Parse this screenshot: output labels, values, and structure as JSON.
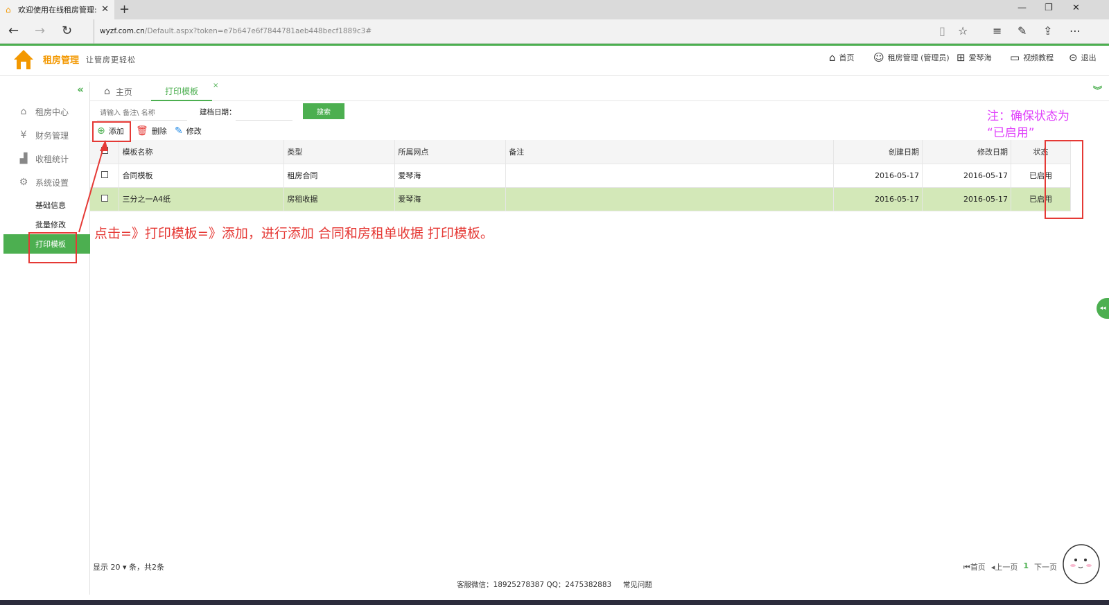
{
  "browser": {
    "tab_title": "欢迎使用在线租房管理:",
    "url_host": "wyzf.com.cn",
    "url_path": "/Default.aspx?token=e7b647e6f7844781aeb448becf1889c3#"
  },
  "header": {
    "brand": "租房管理",
    "slogan": "让管房更轻松",
    "nav": {
      "home": "首页",
      "user": "租房管理 (管理员)",
      "org": "爱琴海",
      "video": "视频教程",
      "logout": "退出"
    }
  },
  "sidebar": {
    "items": [
      {
        "label": "租房中心",
        "icon": "home-icon"
      },
      {
        "label": "财务管理",
        "icon": "finance-icon"
      },
      {
        "label": "收租统计",
        "icon": "bar-chart-icon"
      },
      {
        "label": "系统设置",
        "icon": "gear-icon"
      }
    ],
    "subitems": [
      {
        "label": "基础信息"
      },
      {
        "label": "批量修改"
      },
      {
        "label": "打印模板"
      }
    ]
  },
  "tabs": {
    "home": "主页",
    "active": "打印模板",
    "close": "×"
  },
  "search": {
    "placeholder": "请输入 备注\\ 名称",
    "date_label": "建档日期：",
    "button": "搜索"
  },
  "toolbar": {
    "add": "添加",
    "delete": "删除",
    "edit": "修改"
  },
  "table": {
    "headers": [
      "模板名称",
      "类型",
      "所属网点",
      "备注",
      "创建日期",
      "修改日期",
      "状态"
    ],
    "rows": [
      [
        "合同模板",
        "租房合同",
        "爱琴海",
        "",
        "2016-05-17",
        "2016-05-17",
        "已启用"
      ],
      [
        "三分之一A4纸",
        "房租收据",
        "爱琴海",
        "",
        "2016-05-17",
        "2016-05-17",
        "已启用"
      ]
    ]
  },
  "pager": {
    "show_prefix": "显示",
    "page_size": "20",
    "summary": "条，共2条",
    "first": "首页",
    "prev": "上一页",
    "current": "1",
    "next": "下一页"
  },
  "footer": {
    "service": "客服微信：18925278387  QQ：2475382883",
    "faq": "常见问题"
  },
  "annotations": {
    "instruction": "点击=》打印模板=》添加，进行添加 合同和房租单收据 打印模板。",
    "note_line1": "注：确保状态为",
    "note_line2": "“已启用”"
  },
  "colors": {
    "accent": "#4caf50",
    "brand": "#f39800",
    "annotation_red": "#e53935",
    "annotation_pink": "#e040fb",
    "selected_row": "#d3e8b8"
  }
}
